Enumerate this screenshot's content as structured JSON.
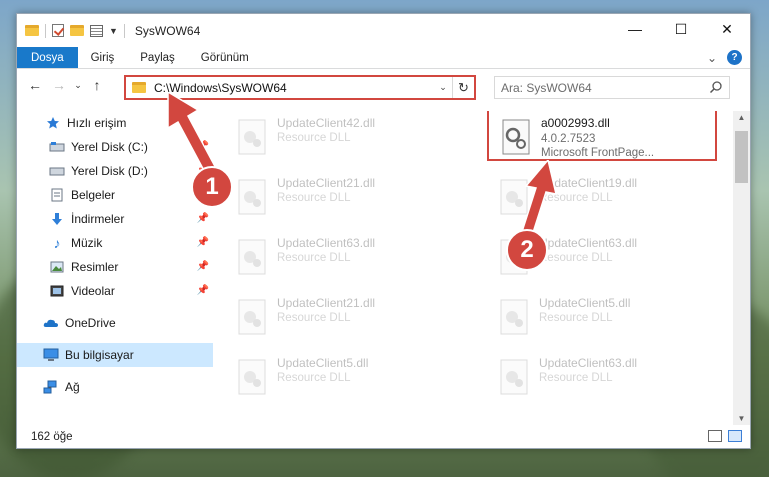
{
  "window": {
    "title": "SysWOW64",
    "controls": {
      "minimize": "—",
      "maximize": "☐",
      "close": "✕"
    }
  },
  "ribbon": {
    "tabs": [
      "Dosya",
      "Giriş",
      "Paylaş",
      "Görünüm"
    ],
    "collapse": "⌄",
    "help": "?"
  },
  "nav": {
    "back": "←",
    "forward": "→",
    "recent": "⌄",
    "up": "↑"
  },
  "address": {
    "path": "C:\\Windows\\SysWOW64",
    "dropdown": "⌄",
    "refresh": "↻"
  },
  "search": {
    "placeholder": "Ara: SysWOW64"
  },
  "sidebar": {
    "items": [
      {
        "label": "Hızlı erişim",
        "icon": "star-icon"
      },
      {
        "label": "Yerel Disk (C:)",
        "icon": "drive-icon",
        "pinned": true
      },
      {
        "label": "Yerel Disk (D:)",
        "icon": "drive-icon",
        "pinned": true
      },
      {
        "label": "Belgeler",
        "icon": "documents-icon",
        "pinned": true
      },
      {
        "label": "İndirmeler",
        "icon": "download-icon",
        "pinned": true
      },
      {
        "label": "Müzik",
        "icon": "music-icon",
        "pinned": true
      },
      {
        "label": "Resimler",
        "icon": "pictures-icon",
        "pinned": true
      },
      {
        "label": "Videolar",
        "icon": "videos-icon",
        "pinned": true
      },
      {
        "label": "OneDrive",
        "icon": "cloud-icon"
      },
      {
        "label": "Bu bilgisayar",
        "icon": "computer-icon",
        "selected": true
      },
      {
        "label": "Ağ",
        "icon": "network-icon"
      }
    ]
  },
  "files": {
    "highlighted": {
      "name": "a0002993.dll",
      "version": "4.0.2.7523",
      "description": "Microsoft FrontPage..."
    },
    "left_column": [
      {
        "name": "UpdateClient42.dll",
        "desc": "Resource DLL"
      },
      {
        "name": "UpdateClient21.dll",
        "desc": "Resource DLL"
      },
      {
        "name": "UpdateClient63.dll",
        "desc": "Resource DLL"
      },
      {
        "name": "UpdateClient21.dll",
        "desc": "Resource DLL"
      },
      {
        "name": "UpdateClient5.dll",
        "desc": "Resource DLL"
      }
    ],
    "right_column": [
      {
        "name": "UpdateClient19.dll",
        "desc": "Resource DLL"
      },
      {
        "name": "UpdateClient63.dll",
        "desc": "Resource DLL"
      },
      {
        "name": "UpdateClient5.dll",
        "desc": "Resource DLL"
      },
      {
        "name": "UpdateClient63.dll",
        "desc": "Resource DLL"
      }
    ]
  },
  "status": {
    "count": "162 öğe"
  },
  "annotations": {
    "step1": "1",
    "step2": "2",
    "color": "#d2473f"
  }
}
